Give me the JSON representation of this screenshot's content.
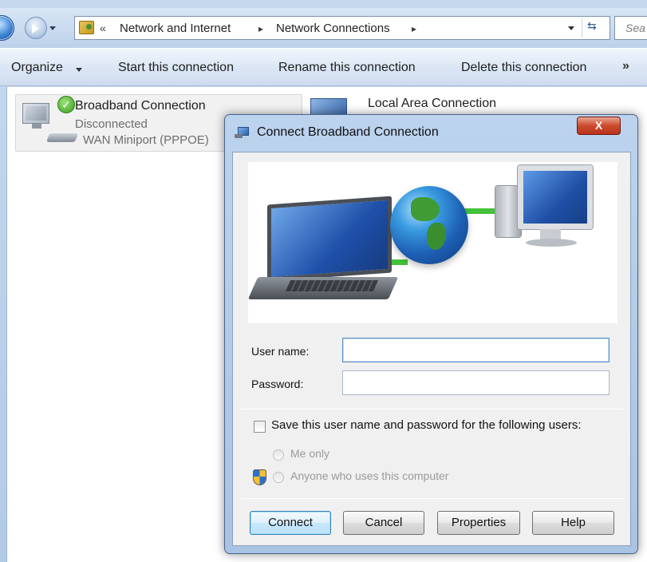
{
  "explorer": {
    "breadcrumb": {
      "overflow": "«",
      "items": [
        "Network and Internet",
        "Network Connections"
      ],
      "separator": "▸"
    },
    "search_placeholder": "Sea",
    "toolbar": {
      "organize": "Organize",
      "start": "Start this connection",
      "rename": "Rename this connection",
      "delete": "Delete this connection",
      "more": "»"
    },
    "connections": [
      {
        "name": "Broadband Connection",
        "status": "Disconnected",
        "device": "WAN Miniport (PPPOE)"
      },
      {
        "name": "Local Area Connection"
      }
    ]
  },
  "dialog": {
    "title": "Connect Broadband Connection",
    "close_glyph": "X",
    "username_label": "User name:",
    "username_value": "",
    "password_label": "Password:",
    "password_value": "",
    "save_checkbox_label": "Save this user name and password for the following users:",
    "save_checked": false,
    "radio_me_only": "Me only",
    "radio_anyone": "Anyone who uses this computer",
    "buttons": {
      "connect": "Connect",
      "cancel": "Cancel",
      "properties": "Properties",
      "help": "Help"
    }
  },
  "colors": {
    "window_chrome": "#b3cae6",
    "close_button": "#cc4b2e",
    "link_green": "#43c23a",
    "default_button_border": "#3c7fb1"
  },
  "icons": [
    "back-icon",
    "forward-icon",
    "address-folder-icon",
    "refresh-icon",
    "network-computer-icon",
    "connected-check-icon",
    "modem-icon",
    "lan-icon",
    "dialog-network-icon",
    "uac-shield-icon"
  ]
}
